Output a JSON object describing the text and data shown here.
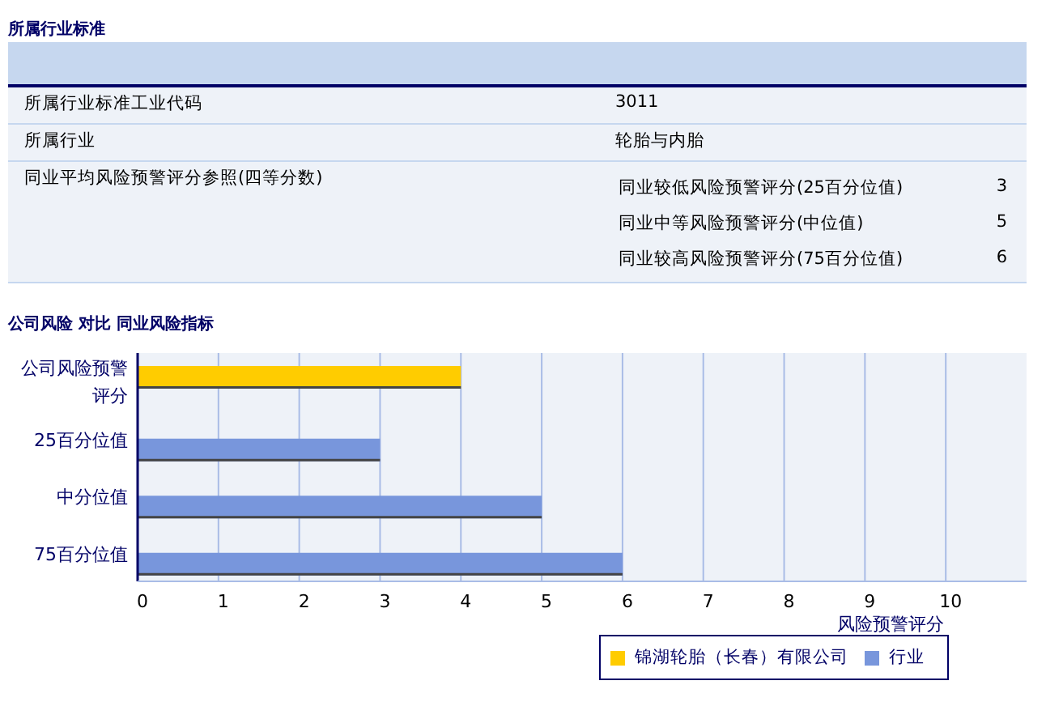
{
  "section_title": "所属行业标准",
  "table": {
    "rows": [
      {
        "label": "所属行业标准工业代码",
        "value": "3011"
      },
      {
        "label": "所属行业",
        "value": "轮胎与内胎"
      },
      {
        "label": "同业平均风险预警评分参照(四等分数)",
        "sub_rows": [
          {
            "label": "同业较低风险预警评分(25百分位值)",
            "value": "3"
          },
          {
            "label": "同业中等风险预警评分(中位值)",
            "value": "5"
          },
          {
            "label": "同业较高风险预警评分(75百分位值)",
            "value": "6"
          }
        ]
      }
    ]
  },
  "chart_section": {
    "title": "公司风险 对比 同业风险指标",
    "chart_data": {
      "type": "bar",
      "orientation": "horizontal",
      "xlabel": "风险预警评分",
      "categories": [
        "公司风险预警评分",
        "25百分位值",
        "中分位值",
        "75百分位值"
      ],
      "series": [
        {
          "name": "锦湖轮胎（长春）有限公司",
          "color": "#ffcc00",
          "values": [
            4,
            null,
            null,
            null
          ]
        },
        {
          "name": "行业",
          "color": "#7896dc",
          "values": [
            null,
            3,
            5,
            6
          ]
        }
      ],
      "grid": true,
      "legend": true,
      "xlim": [
        0,
        11
      ],
      "xticks": [
        {
          "value": 0,
          "label": "0"
        },
        {
          "value": 1,
          "label": "1"
        },
        {
          "value": 2,
          "label": "2"
        },
        {
          "value": 3,
          "label": "3"
        },
        {
          "value": 4,
          "label": "4"
        },
        {
          "value": 5,
          "label": "5"
        },
        {
          "value": 6,
          "label": "6"
        },
        {
          "value": 7,
          "label": "7"
        },
        {
          "value": 8,
          "label": "8"
        },
        {
          "value": 9,
          "label": "9"
        },
        {
          "value": 10,
          "label": "10"
        }
      ]
    }
  }
}
